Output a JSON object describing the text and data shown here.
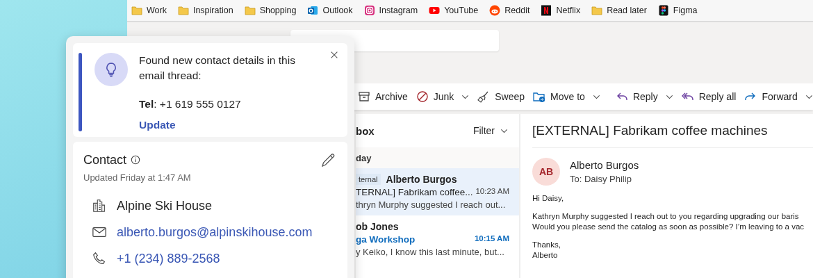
{
  "bookmarks": [
    {
      "label": "Work",
      "kind": "folder"
    },
    {
      "label": "Inspiration",
      "kind": "folder"
    },
    {
      "label": "Shopping",
      "kind": "folder"
    },
    {
      "label": "Outlook",
      "kind": "outlook"
    },
    {
      "label": "Instagram",
      "kind": "instagram"
    },
    {
      "label": "YouTube",
      "kind": "youtube"
    },
    {
      "label": "Reddit",
      "kind": "reddit"
    },
    {
      "label": "Netflix",
      "kind": "netflix"
    },
    {
      "label": "Read later",
      "kind": "folder"
    },
    {
      "label": "Figma",
      "kind": "figma"
    }
  ],
  "toolbar": [
    {
      "label": "Archive",
      "kind": "archive",
      "dropdown": false
    },
    {
      "label": "Junk",
      "kind": "junk",
      "dropdown": true
    },
    {
      "label": "Sweep",
      "kind": "sweep",
      "dropdown": false
    },
    {
      "label": "Move to",
      "kind": "move",
      "dropdown": true
    },
    {
      "label": "Reply",
      "kind": "reply",
      "dropdown": true
    },
    {
      "label": "Reply all",
      "kind": "replyall",
      "dropdown": false
    },
    {
      "label": "Forward",
      "kind": "forward",
      "dropdown": true
    }
  ],
  "mail_list": {
    "header": "box",
    "filter": "Filter",
    "group": "day",
    "messages": [
      {
        "badge": "ternal",
        "sender": "Alberto Burgos",
        "subject": "TERNAL] Fabrikam coffee...",
        "time": "10:23 AM",
        "preview": "thryn Murphy suggested I reach out...",
        "selected": true,
        "unread": false
      },
      {
        "sender": "ob Jones",
        "subject": "ga Workshop",
        "time": "10:15 AM",
        "preview": "y Keiko, I know this last minute, but...",
        "selected": false,
        "unread": true
      }
    ]
  },
  "reading_pane": {
    "subject": "[EXTERNAL] Fabrikam coffee machines",
    "initials": "AB",
    "sender": "Alberto Burgos",
    "to": "To: Daisy Philip",
    "paragraphs": [
      [
        "Hi Daisy,"
      ],
      [
        "Kathryn Murphy suggested I reach out to you regarding upgrading our baris",
        "Would you please send the catalog as soon as possible? I’m leaving to a vac"
      ],
      [
        "Thanks,",
        "Alberto"
      ]
    ]
  },
  "popup": {
    "message": "Found new contact details in this email thread:",
    "detail": "**Tel**: +1 619 555 0127",
    "action": "Update",
    "contact": {
      "title": "Contact",
      "updated": "Updated Friday at 1:47 AM",
      "fields": [
        {
          "kind": "company",
          "value": "Alpine Ski House"
        },
        {
          "kind": "email",
          "value": "alberto.burgos@alpinskihouse.com"
        },
        {
          "kind": "phone",
          "value": "+1 (234) 889-2568"
        }
      ]
    }
  }
}
